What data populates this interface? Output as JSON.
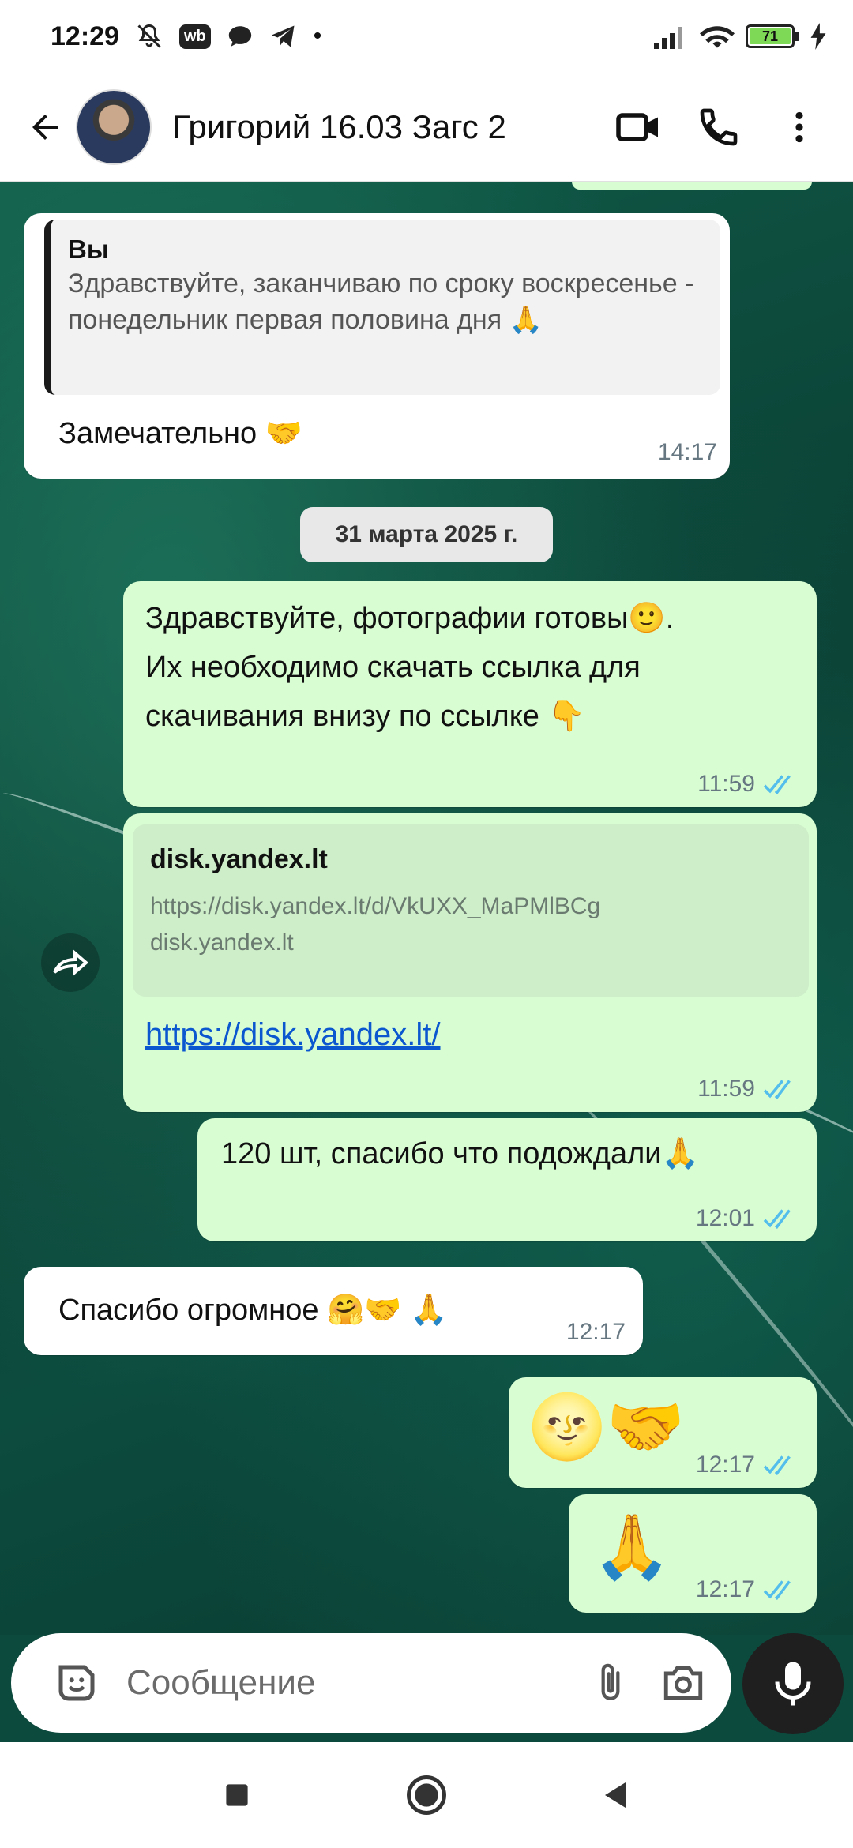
{
  "status_bar": {
    "time": "12:29",
    "wb_badge": "wb",
    "dot": "•",
    "battery": "71"
  },
  "header": {
    "contact_name": "Григорий 16.03 Загс 2"
  },
  "messages": [
    {
      "id": "m1",
      "direction": "incoming",
      "quote_author": "Вы",
      "quote_text": "Здравствуйте, заканчиваю по сроку воскресенье - понедельник первая половина дня 🙏",
      "text": "Замечательно 🤝",
      "time": "14:17"
    },
    {
      "id": "m2",
      "direction": "outgoing",
      "text_line1": "Здравствуйте, фотографии готовы🙂.",
      "text_line2": "Их необходимо скачать ссылка для",
      "text_line3": "скачивания внизу по ссылке 👇",
      "time": "11:59",
      "status": "read"
    },
    {
      "id": "m3",
      "direction": "outgoing",
      "preview_title": "disk.yandex.lt",
      "preview_url": "https://disk.yandex.lt/d/VkUXX_MaPMlBCg",
      "preview_domain": "disk.yandex.lt",
      "link_text": "https://disk.yandex.lt/",
      "time": "11:59",
      "status": "read"
    },
    {
      "id": "m4",
      "direction": "outgoing",
      "text": "120 шт, спасибо что подождали🙏",
      "time": "12:01",
      "status": "read"
    },
    {
      "id": "m5",
      "direction": "incoming",
      "text": "Спасибо огромное 🤗🤝 🙏",
      "time": "12:17"
    },
    {
      "id": "m6",
      "direction": "outgoing",
      "text": "🌝🤝",
      "time": "12:17",
      "status": "read"
    },
    {
      "id": "m7",
      "direction": "outgoing",
      "text": "🙏",
      "time": "12:17",
      "status": "read"
    }
  ],
  "date_separator": "31 марта 2025 г.",
  "input": {
    "placeholder": "Сообщение"
  },
  "colors": {
    "outgoing_bubble": "#d9fdd3",
    "incoming_bubble": "#ffffff",
    "read_ticks": "#53bdeb",
    "link": "#0b57d0",
    "chat_background": "#0d4a3e"
  },
  "icons": {
    "back": "arrow-left-icon",
    "video": "video-camera-icon",
    "call": "phone-icon",
    "menu": "more-vertical-icon",
    "emoji": "sticker-icon",
    "attach": "paperclip-icon",
    "camera": "camera-icon",
    "mic": "microphone-icon",
    "forward": "forward-icon"
  }
}
